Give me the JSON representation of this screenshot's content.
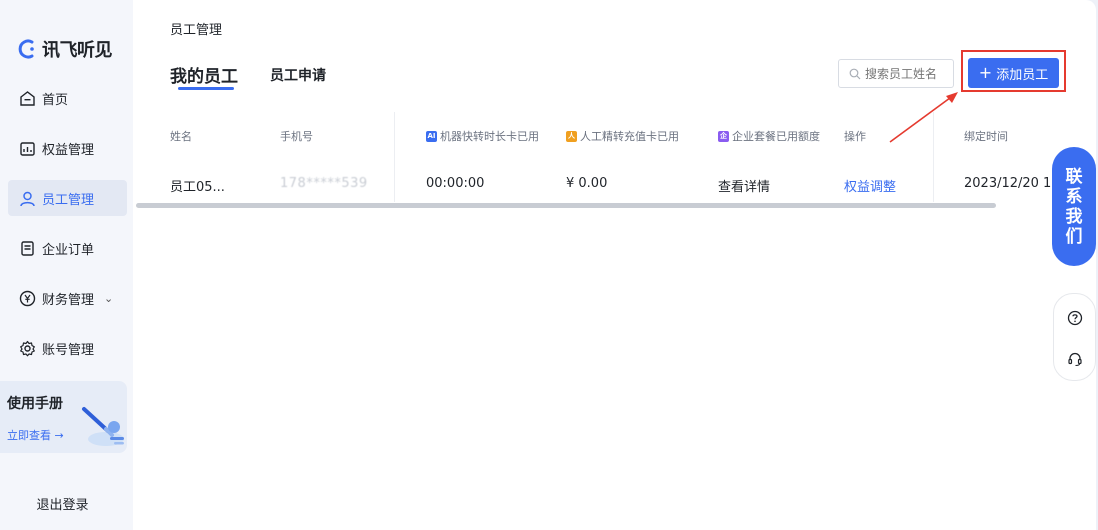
{
  "brand": {
    "name": "讯飞听见",
    "accent": "#3a6df0"
  },
  "sidebar": {
    "items": [
      {
        "label": "首页",
        "icon": "home-icon"
      },
      {
        "label": "权益管理",
        "icon": "chart-icon"
      },
      {
        "label": "员工管理",
        "icon": "user-icon",
        "active": true
      },
      {
        "label": "企业订单",
        "icon": "order-icon"
      },
      {
        "label": "财务管理",
        "icon": "yuan-icon",
        "caret": "⌄"
      },
      {
        "label": "账号管理",
        "icon": "gear-icon"
      }
    ],
    "manual": {
      "title": "使用手册",
      "link": "立即查看 →"
    },
    "logout": "退出登录"
  },
  "main": {
    "breadcrumb": "员工管理",
    "tabs": [
      {
        "label": "我的员工",
        "active": true
      },
      {
        "label": "员工申请"
      }
    ],
    "search": {
      "placeholder": "搜索员工姓名"
    },
    "add_button": "添加员工",
    "add_button_icon": "+",
    "table": {
      "headers": [
        {
          "label": "姓名"
        },
        {
          "label": "手机号"
        },
        {
          "label": "机器快转时长卡已用",
          "badge": "AI",
          "badge_color": "#3a6df0"
        },
        {
          "label": "人工精转充值卡已用",
          "badge": "人",
          "badge_color": "#f0a020"
        },
        {
          "label": "企业套餐已用额度",
          "badge": "企",
          "badge_color": "#8a5cf0"
        },
        {
          "label": "操作"
        },
        {
          "label": "绑定时间"
        }
      ],
      "rows": [
        {
          "name": "员工05...",
          "phone": "178*****539",
          "machine_used": "00:00:00",
          "human_used": "¥ 0.00",
          "action_detail": "查看详情",
          "action_adjust": "权益调整",
          "bind_time": "2023/12/20 15"
        }
      ]
    }
  },
  "floating": {
    "contact": [
      "联",
      "系",
      "我",
      "们"
    ],
    "help_icons": [
      "question-icon",
      "headset-icon"
    ]
  }
}
